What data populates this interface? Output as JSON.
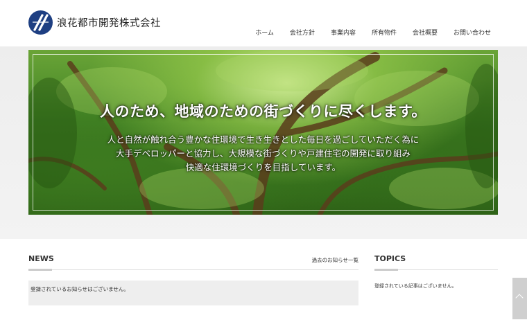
{
  "header": {
    "company_name": "浪花都市開発株式会社",
    "nav": [
      "ホーム",
      "会社方針",
      "事業内容",
      "所有物件",
      "会社概要",
      "お問い合わせ"
    ]
  },
  "hero": {
    "title": "人のため、地域のための街づくりに尽くします。",
    "lines": [
      "人と自然が触れ合う豊かな住環境で生き生きとした毎日を過ごしていただく為に",
      "大手デベロッパーと協力し、大規模な街づくりや戸建住宅の開発に取り組み",
      "快適な住環境づくりを目指しています。"
    ]
  },
  "news": {
    "title": "NEWS",
    "archive_link": "過去のお知らせ一覧",
    "empty_message": "登録されているお知らせはございません。"
  },
  "topics": {
    "title": "TOPICS",
    "empty_message": "登録されている記事はございません。"
  },
  "colors": {
    "brand": "#1e3f82",
    "foliage": "#3f8124"
  }
}
